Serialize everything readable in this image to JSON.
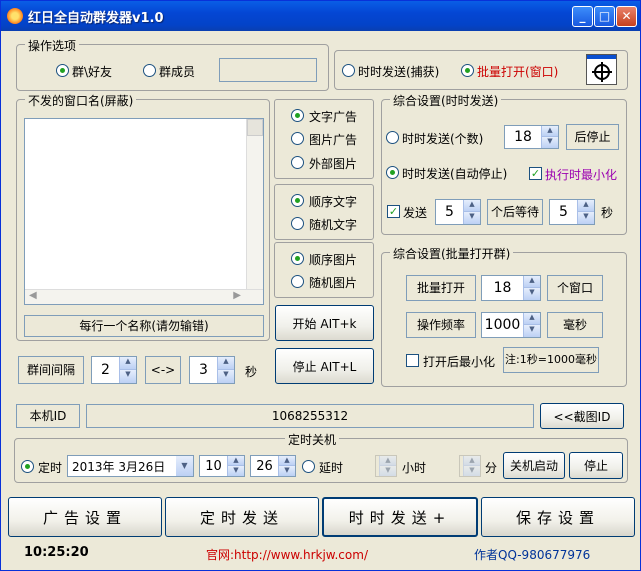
{
  "window": {
    "title": "红日全自动群发器v1.0",
    "min": "_",
    "max": "□",
    "close": "✕"
  },
  "ops": {
    "title": "操作选项",
    "friends": "群\\好友",
    "members": "群成员",
    "send_capture": "时时发送(捕获)",
    "batch_open": "批量打开(窗口)"
  },
  "blocked": {
    "title": "不发的窗口名(屏蔽)",
    "hint": "每行一个名称(请勿输错)"
  },
  "content": {
    "text_ad": "文字广告",
    "image_ad": "图片广告",
    "external_image": "外部图片",
    "seq_text": "顺序文字",
    "rand_text": "随机文字",
    "seq_image": "顺序图片",
    "rand_image": "随机图片"
  },
  "actions": {
    "start": "开始 AIT+k",
    "stop": "停止 AIT+L"
  },
  "interval": {
    "label": "群间间隔",
    "min": "2",
    "sep": "<->",
    "max": "3",
    "unit": "秒"
  },
  "realtime": {
    "title": "综合设置(时时发送)",
    "count_label": "时时发送(个数)",
    "count": "18",
    "stop_after": "后停止",
    "auto_stop": "时时发送(自动停止)",
    "minimize": "执行时最小化",
    "send": "发送",
    "send_n": "5",
    "wait_label": "个后等待",
    "wait": "5",
    "sec": "秒"
  },
  "batch": {
    "title": "综合设置(批量打开群)",
    "open": "批量打开",
    "open_n": "18",
    "windows": "个窗口",
    "freq": "操作频率",
    "freq_v": "1000",
    "ms": "毫秒",
    "min_after": "打开后最小化",
    "note": "注:1秒=1000毫秒"
  },
  "machine": {
    "id_label": "本机ID",
    "id_value": "1068255312",
    "capture": "<<截图ID"
  },
  "shutdown": {
    "title": "定时关机",
    "timed": "定时",
    "date": "2013年 3月26日",
    "hour": "10",
    "minute": "26",
    "delay": "延时",
    "hour_unit": "小时",
    "min_unit": "分",
    "start": "关机启动",
    "stop": "停止"
  },
  "tabs": [
    "广告设置",
    "定时发送",
    "时时发送+",
    "保存设置"
  ],
  "status": {
    "time": "10:25:20",
    "site": "官网:http://www.hrkjw.com/",
    "author": "作者QQ-980677976"
  },
  "colors": {
    "accent_red": "#cc0000",
    "purple": "#9b00b0",
    "blue": "#003399"
  }
}
